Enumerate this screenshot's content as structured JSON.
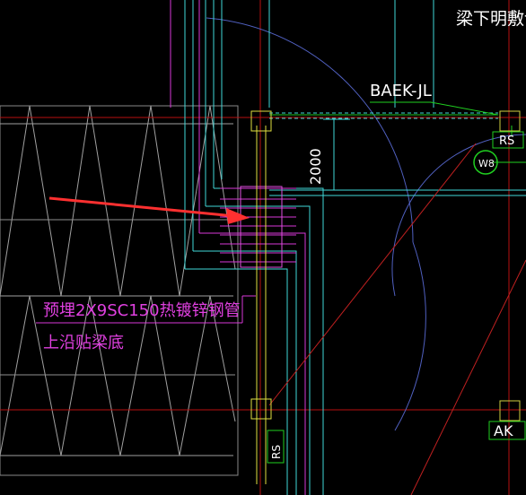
{
  "drawing": {
    "title_fragment": "梁下明敷设",
    "label_baek": "BAEK-JL",
    "dimension_2000": "2000",
    "tag_rs_top": "RS",
    "tag_rs_bottom": "RS",
    "tag_circle": "W8",
    "tag_ak": "AK",
    "note_line1": "预埋2X9SC150热镀锌钢管",
    "note_line2": "上沿贴梁底"
  },
  "colors": {
    "background": "#000000",
    "white_text": "#ffffff",
    "magenta": "#e040e0",
    "cyan": "#40e0e0",
    "yellow": "#e0e040",
    "green": "#20d020",
    "red": "#d02020",
    "arrow": "#ff3030",
    "grid_red": "#c01010",
    "hatch_gray": "#b0b0b0",
    "arc_blue": "#6070d0"
  }
}
